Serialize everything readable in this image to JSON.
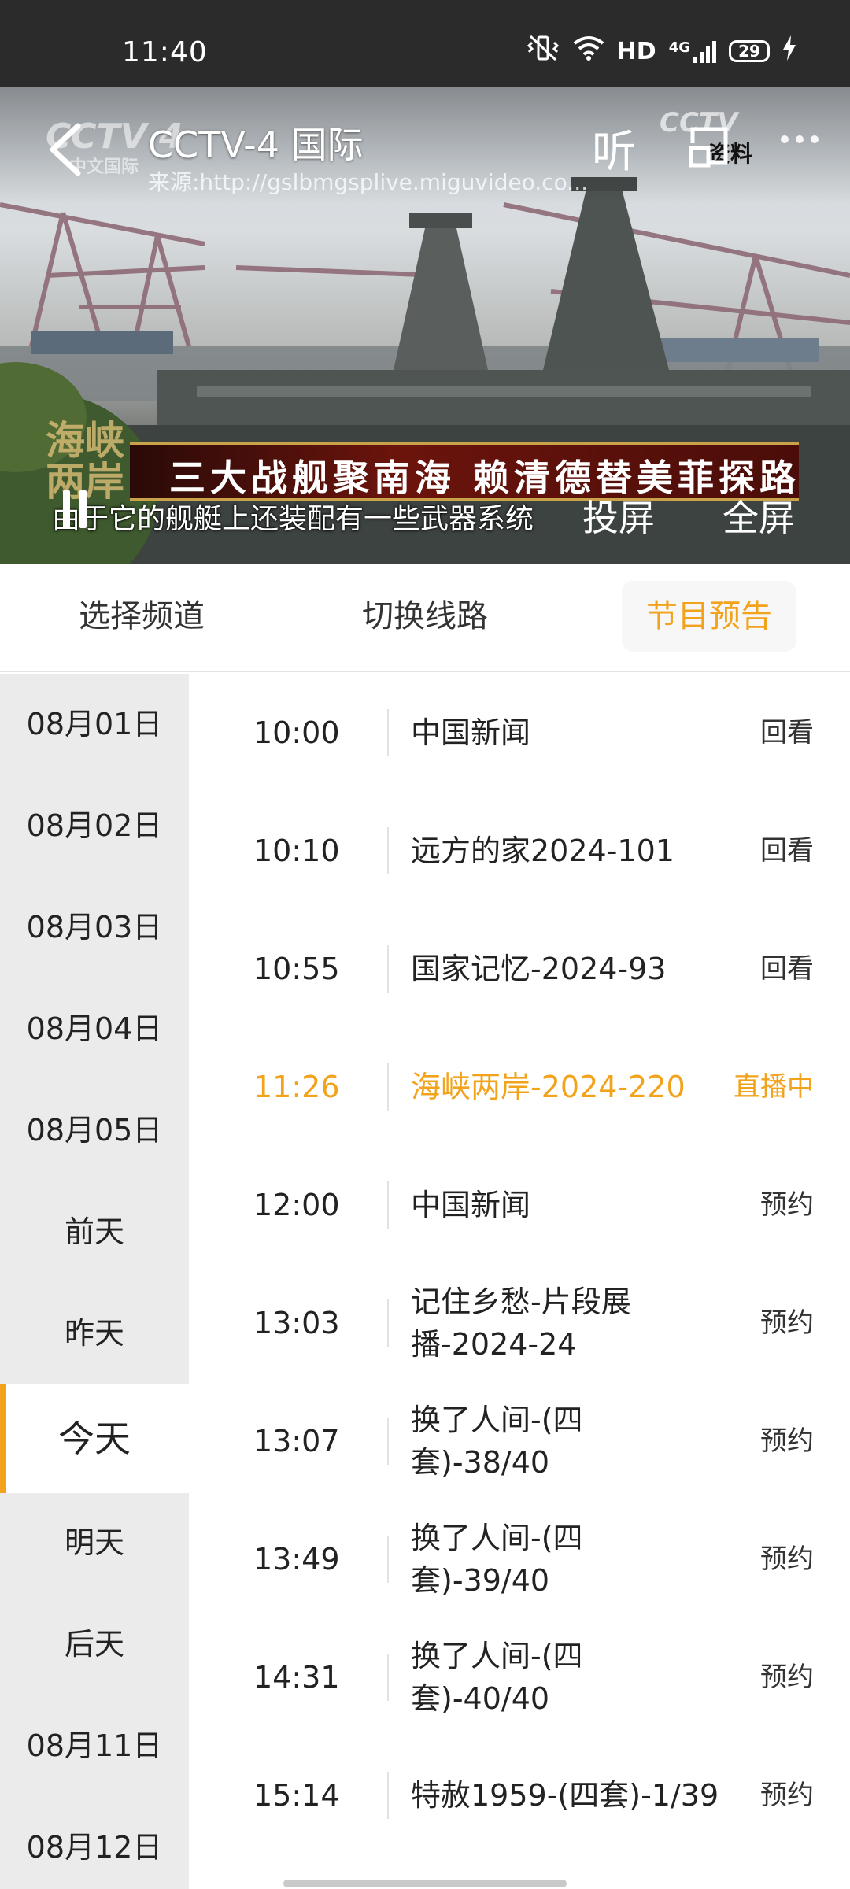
{
  "status_bar": {
    "time": "11:40",
    "network": "HD",
    "signal_type": "4G",
    "battery": "29",
    "icons": [
      "mute-vibrate-icon",
      "wifi-icon",
      "signal-icon",
      "battery-icon",
      "charging-icon"
    ]
  },
  "player": {
    "channel_title": "CCTV-4 国际",
    "source": "来源:http://gslbmgsplive.miguvideo.co...",
    "listen_label": "听",
    "cast_label": "投屏",
    "fullscreen_label": "全屏",
    "news_banner": "三大战舰聚南海 赖清德替美菲探路",
    "subtitle": "由于它的舰艇上还装配有一些武器系统",
    "logo_top": "CCTV 4",
    "logo_sub": "中文国际",
    "program_logo_line1": "海峡",
    "program_logo_line2": "两岸",
    "watermark_right": "CCTV",
    "watermark_tag": "资料"
  },
  "tabs": [
    {
      "label": "选择频道",
      "active": false
    },
    {
      "label": "切换线路",
      "active": false
    },
    {
      "label": "节目预告",
      "active": true
    }
  ],
  "dates": [
    {
      "label": "08月01日",
      "active": false
    },
    {
      "label": "08月02日",
      "active": false
    },
    {
      "label": "08月03日",
      "active": false
    },
    {
      "label": "08月04日",
      "active": false
    },
    {
      "label": "08月05日",
      "active": false
    },
    {
      "label": "前天",
      "active": false
    },
    {
      "label": "昨天",
      "active": false
    },
    {
      "label": "今天",
      "active": true
    },
    {
      "label": "明天",
      "active": false
    },
    {
      "label": "后天",
      "active": false
    },
    {
      "label": "08月11日",
      "active": false
    },
    {
      "label": "08月12日",
      "active": false
    }
  ],
  "programs": [
    {
      "time": "10:00",
      "title": "中国新闻",
      "action": "回看",
      "live": false
    },
    {
      "time": "10:10",
      "title": "远方的家2024-101",
      "action": "回看",
      "live": false
    },
    {
      "time": "10:55",
      "title": "国家记忆-2024-93",
      "action": "回看",
      "live": false
    },
    {
      "time": "11:26",
      "title": "海峡两岸-2024-220",
      "action": "直播中",
      "live": true
    },
    {
      "time": "12:00",
      "title": "中国新闻",
      "action": "预约",
      "live": false
    },
    {
      "time": "13:03",
      "title": "记住乡愁-片段展播-2024-24",
      "action": "预约",
      "live": false
    },
    {
      "time": "13:07",
      "title": "换了人间-(四套)-38/40",
      "action": "预约",
      "live": false
    },
    {
      "time": "13:49",
      "title": "换了人间-(四套)-39/40",
      "action": "预约",
      "live": false
    },
    {
      "time": "14:31",
      "title": "换了人间-(四套)-40/40",
      "action": "预约",
      "live": false
    },
    {
      "time": "15:14",
      "title": "特赦1959-(四套)-1/39",
      "action": "预约",
      "live": false
    }
  ],
  "colors": {
    "accent": "#f2a31b",
    "status_bar": "#2b2b2b",
    "date_column": "#ebebeb"
  }
}
